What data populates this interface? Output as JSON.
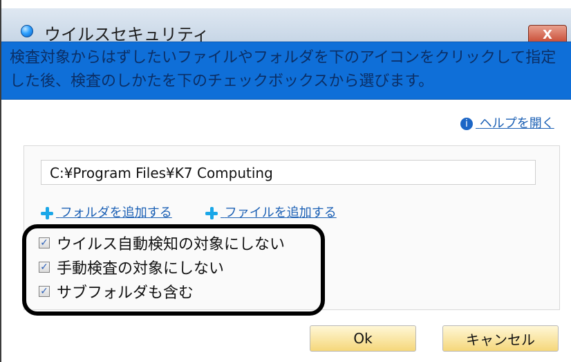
{
  "window": {
    "title": "ウイルスセキュリティ",
    "close_label": "X"
  },
  "banner": {
    "text": "検査対象からはずしたいファイルやフォルダを下のアイコンをクリックして指定した後、検査のしかたを下のチェックボックスから選びます。"
  },
  "help": {
    "label": "ヘルプを開く",
    "icon": "i"
  },
  "panel": {
    "path_value": "C:¥Program Files¥K7 Computing",
    "add_folder_label": "フォルダを追加する",
    "add_file_label": "ファイルを追加する",
    "options": [
      {
        "label": "ウイルス自動検知の対象にしない",
        "checked": true
      },
      {
        "label": "手動検査の対象にしない",
        "checked": true
      },
      {
        "label": "サブフォルダも含む",
        "checked": true
      }
    ]
  },
  "buttons": {
    "ok_label": "Ok",
    "cancel_label": "キャンセル"
  }
}
